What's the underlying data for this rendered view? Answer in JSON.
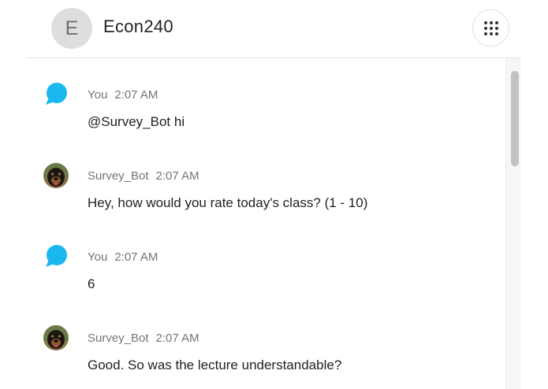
{
  "header": {
    "avatar_letter": "E",
    "title": "Econ240",
    "apps_icon": "grid-dots-icon"
  },
  "messages": [
    {
      "sender": "You",
      "time": "2:07 AM",
      "text": "@Survey_Bot hi",
      "avatar": "chat-bubble-icon"
    },
    {
      "sender": "Survey_Bot",
      "time": "2:07 AM",
      "text": "Hey, how would you rate today's class? (1 - 10)",
      "avatar": "dog-avatar"
    },
    {
      "sender": "You",
      "time": "2:07 AM",
      "text": "6",
      "avatar": "chat-bubble-icon"
    },
    {
      "sender": "Survey_Bot",
      "time": "2:07 AM",
      "text": "Good. So was the lecture understandable?",
      "avatar": "dog-avatar"
    }
  ],
  "colors": {
    "bubble_icon": "#1ab8ee",
    "meta_text": "#757575",
    "divider": "#e3e3e3"
  }
}
